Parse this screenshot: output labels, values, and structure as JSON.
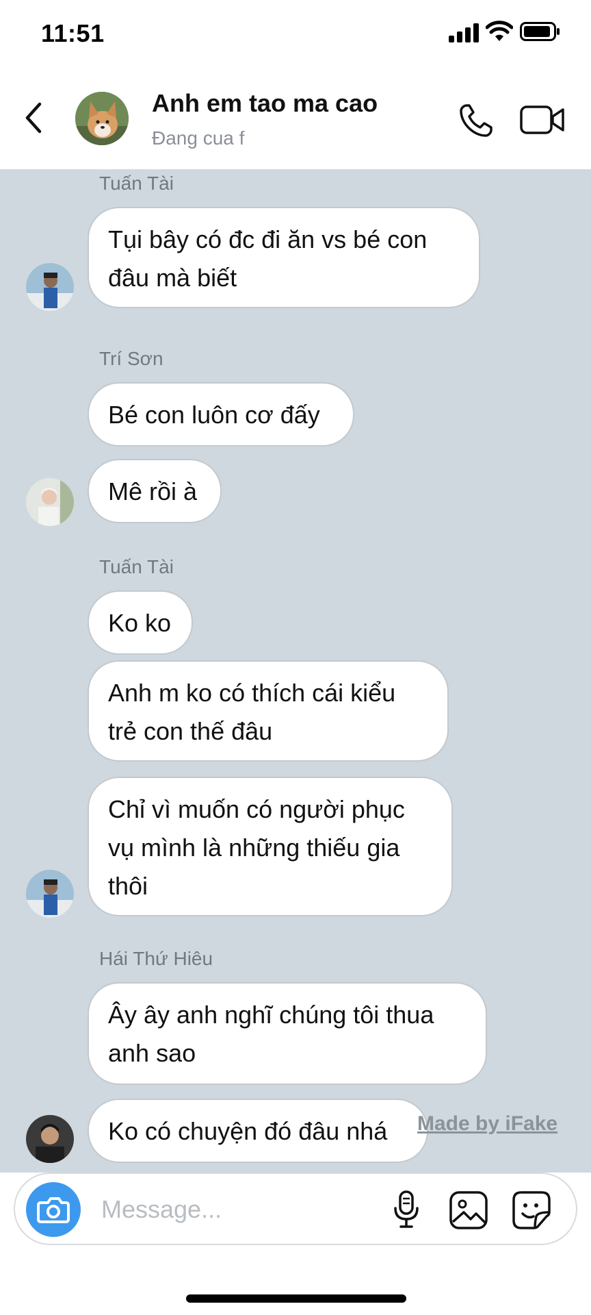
{
  "status_bar": {
    "time": "11:51",
    "icons": [
      "signal-icon",
      "wifi-icon",
      "battery-icon"
    ]
  },
  "header": {
    "group_name": "Anh em tao ma cao",
    "status": "Đang cua f",
    "icons": [
      "back-arrow-icon",
      "phone-icon",
      "video-camera-icon"
    ]
  },
  "messages": [
    {
      "sender": "Tuấn Tài",
      "bubbles": [
        "Tụi bây có đc đi ăn vs bé con đâu mà biết"
      ]
    },
    {
      "sender": "Trí Sơn",
      "bubbles": [
        "Bé con luôn cơ đấy",
        "Mê rồi à"
      ]
    },
    {
      "sender": "Tuấn Tài",
      "bubbles": [
        "Ko ko",
        "Anh m ko có thích cái kiểu trẻ con thế đâu",
        "Chỉ vì muốn có người phục vụ mình là những thiếu gia thôi"
      ]
    },
    {
      "sender": "Hái Thứ Hiêu",
      "bubbles": [
        "Ây ây anh nghĩ chúng tôi thua anh sao",
        "Ko có chuyện đó đâu nhá"
      ]
    }
  ],
  "watermark": "Made by iFake",
  "composer": {
    "placeholder": "Message...",
    "icons": [
      "camera-icon",
      "microphone-icon",
      "image-icon",
      "sticker-icon"
    ]
  },
  "colors": {
    "chat_background": "#cfd8de",
    "camera_button": "#3d99ee",
    "bubble": "#ffffff"
  }
}
